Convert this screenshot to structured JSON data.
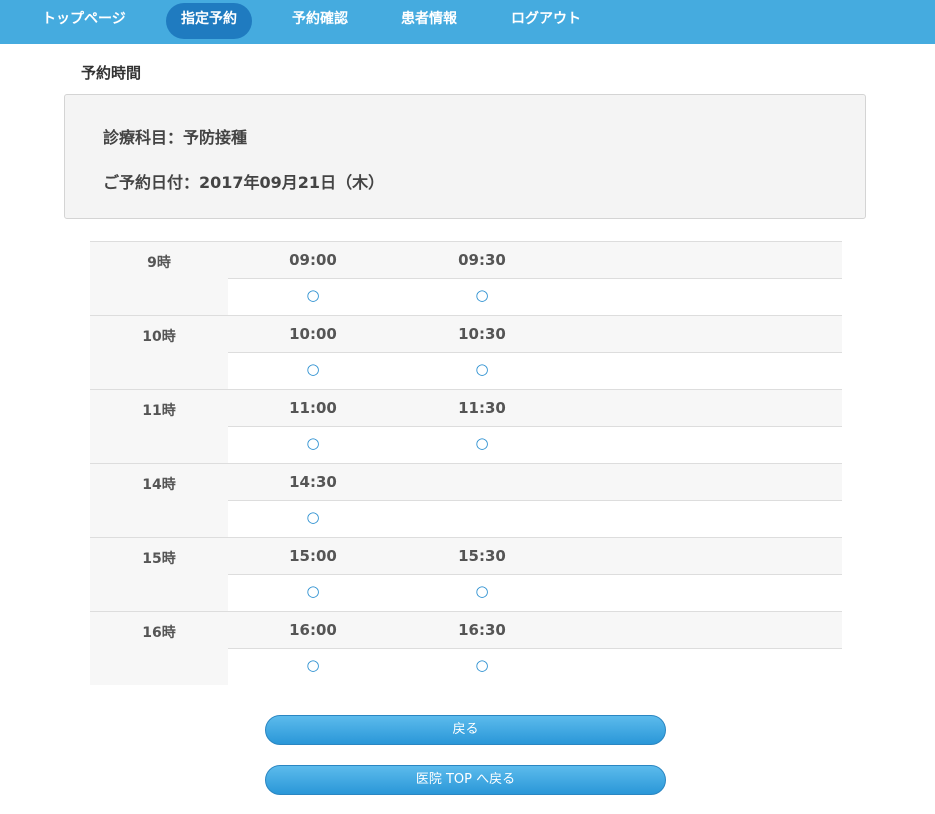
{
  "nav": {
    "items": [
      {
        "label": "トップページ"
      },
      {
        "label": "指定予約"
      },
      {
        "label": "予約確認"
      },
      {
        "label": "患者情報"
      },
      {
        "label": "ログアウト"
      }
    ],
    "active_index": 1
  },
  "section_title": "予約時間",
  "info": {
    "department": "診療科目：予防接種",
    "date": "ご予約日付：2017年09月21日（木）"
  },
  "slots": [
    {
      "hour": "9時",
      "times": [
        {
          "time": "09:00",
          "mark": "○"
        },
        {
          "time": "09:30",
          "mark": "○"
        }
      ]
    },
    {
      "hour": "10時",
      "times": [
        {
          "time": "10:00",
          "mark": "○"
        },
        {
          "time": "10:30",
          "mark": "○"
        }
      ]
    },
    {
      "hour": "11時",
      "times": [
        {
          "time": "11:00",
          "mark": "○"
        },
        {
          "time": "11:30",
          "mark": "○"
        }
      ]
    },
    {
      "hour": "14時",
      "times": [
        {
          "time": "14:30",
          "mark": "○"
        }
      ]
    },
    {
      "hour": "15時",
      "times": [
        {
          "time": "15:00",
          "mark": "○"
        },
        {
          "time": "15:30",
          "mark": "○"
        }
      ]
    },
    {
      "hour": "16時",
      "times": [
        {
          "time": "16:00",
          "mark": "○"
        },
        {
          "time": "16:30",
          "mark": "○"
        }
      ]
    }
  ],
  "buttons": {
    "back": "戻る",
    "hospital_top": "医院 TOP へ戻る"
  },
  "colors": {
    "nav_bg": "#45abdf",
    "nav_active": "#1f7bc0",
    "button": "#2a97d8",
    "mark": "#2a8fd0"
  }
}
